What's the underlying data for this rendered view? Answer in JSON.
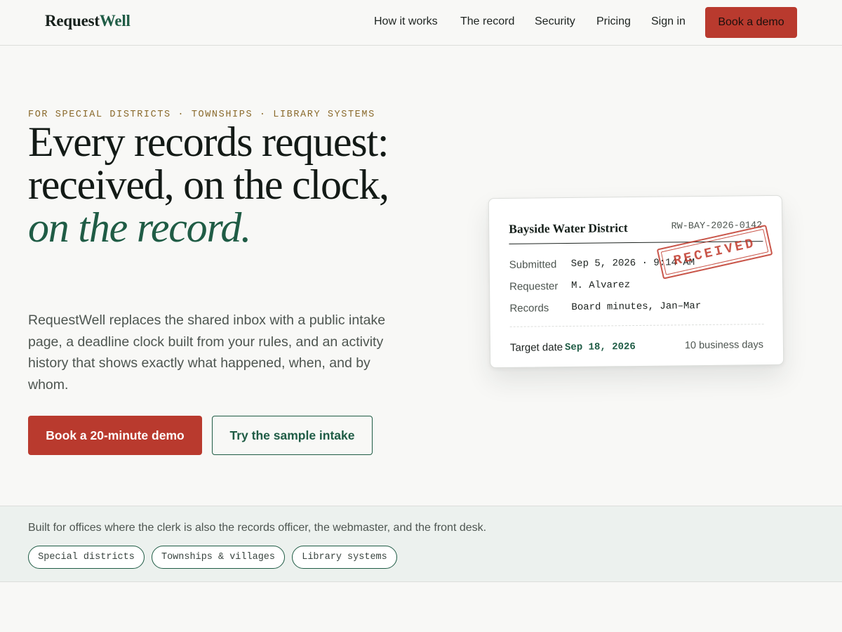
{
  "brand": {
    "name_primary": "Request",
    "name_accent": "Well",
    "accent_color": "#1f5c45",
    "cta_color": "#b93a2e"
  },
  "nav": {
    "items": [
      {
        "label": "How it works"
      },
      {
        "label": "The record"
      },
      {
        "label": "Security"
      },
      {
        "label": "Pricing"
      },
      {
        "label": "Sign in"
      }
    ],
    "cta_label": "Book a demo"
  },
  "hero": {
    "eyebrow": "FOR SPECIAL DISTRICTS · TOWNSHIPS · LIBRARY SYSTEMS",
    "headline_plain": "Every records request: received, on the clock,",
    "headline_emphasis": "on the record.",
    "lede": "RequestWell replaces the shared inbox with a public intake page, a deadline clock built from your rules, and an activity history that shows exactly what happened, when, and by whom.",
    "primary_cta": "Book a 20-minute demo",
    "secondary_cta": "Try the sample intake"
  },
  "record_card": {
    "agency": "Bayside Water District",
    "record_id": "RW-BAY-2026-0142",
    "stamp": "RECEIVED",
    "fields": [
      {
        "label": "Submitted",
        "value": "Sep 5, 2026 · 9:14 AM"
      },
      {
        "label": "Requester",
        "value": "M. Alvarez"
      },
      {
        "label": "Records",
        "value": "Board minutes, Jan–Mar"
      }
    ],
    "target_label": "Target date",
    "target_value": "Sep 18, 2026",
    "target_note": "10 business days"
  },
  "built_for": {
    "text": "Built for offices where the clerk is also the records officer, the webmaster, and the front desk.",
    "chips": [
      {
        "label": "Special districts"
      },
      {
        "label": "Townships & villages"
      },
      {
        "label": "Library systems"
      }
    ]
  }
}
